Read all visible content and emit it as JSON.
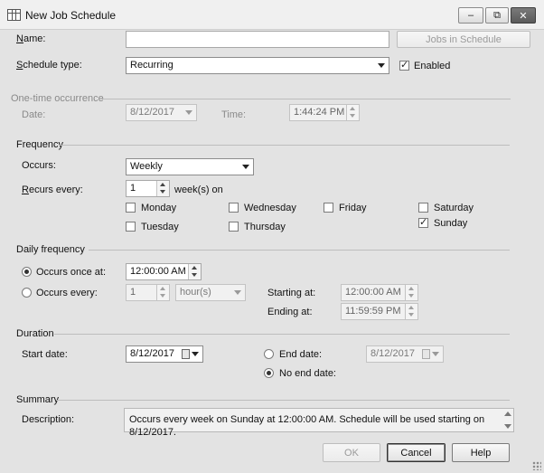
{
  "window": {
    "title": "New Job Schedule",
    "controls": {
      "minimize": "–",
      "restore": "⧉",
      "close": "✕"
    }
  },
  "name": {
    "label": "Name:",
    "value": "",
    "jobs_button": "Jobs in Schedule"
  },
  "schedule_type": {
    "label": "Schedule type:",
    "value": "Recurring",
    "enabled_label": "Enabled",
    "enabled_checked": true
  },
  "onetime": {
    "section": "One-time occurrence",
    "date_label": "Date:",
    "date_value": "8/12/2017",
    "time_label": "Time:",
    "time_value": "1:44:24 PM"
  },
  "frequency": {
    "section": "Frequency",
    "occurs_label": "Occurs:",
    "occurs_value": "Weekly",
    "recurs_label": "Recurs every:",
    "recurs_value": "1",
    "recurs_unit": "week(s) on",
    "days": [
      {
        "label": "Monday",
        "checked": false
      },
      {
        "label": "Tuesday",
        "checked": false
      },
      {
        "label": "Wednesday",
        "checked": false
      },
      {
        "label": "Thursday",
        "checked": false
      },
      {
        "label": "Friday",
        "checked": false
      },
      {
        "label": "Saturday",
        "checked": false
      },
      {
        "label": "Sunday",
        "checked": true
      }
    ]
  },
  "daily": {
    "section": "Daily frequency",
    "once_label": "Occurs once at:",
    "once_value": "12:00:00 AM",
    "once_selected": true,
    "every_label": "Occurs every:",
    "every_value": "1",
    "every_unit": "hour(s)",
    "starting_label": "Starting at:",
    "starting_value": "12:00:00 AM",
    "ending_label": "Ending at:",
    "ending_value": "11:59:59 PM"
  },
  "duration": {
    "section": "Duration",
    "start_label": "Start date:",
    "start_value": "8/12/2017",
    "end_label": "End date:",
    "end_value": "8/12/2017",
    "noend_label": "No end date:",
    "noend_selected": true
  },
  "summary": {
    "section": "Summary",
    "desc_label": "Description:",
    "desc_value": "Occurs every week on Sunday at 12:00:00 AM. Schedule will be used starting on 8/12/2017."
  },
  "buttons": {
    "ok": "OK",
    "cancel": "Cancel",
    "help": "Help"
  }
}
